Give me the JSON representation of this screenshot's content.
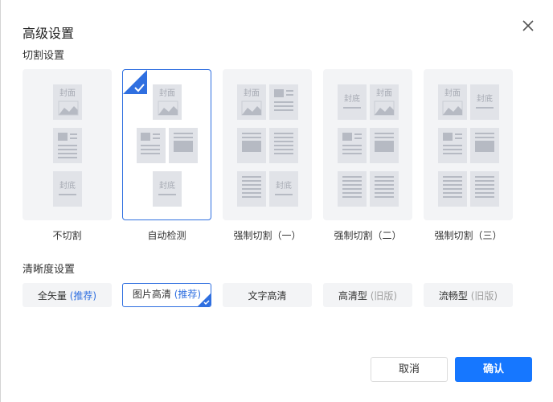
{
  "dialog": {
    "title": "高级设置",
    "close_icon": "close-icon"
  },
  "split_section": {
    "label": "切割设置",
    "options": [
      {
        "label": "不切割",
        "selected": false
      },
      {
        "label": "自动检测",
        "selected": true
      },
      {
        "label": "强制切割（一）",
        "selected": false
      },
      {
        "label": "强制切割（二）",
        "selected": false
      },
      {
        "label": "强制切割（三）",
        "selected": false
      }
    ],
    "thumb_text": {
      "cover": "封面",
      "back": "封底"
    }
  },
  "clarity_section": {
    "label": "清晰度设置",
    "options": [
      {
        "label": "全矢量",
        "tag": "(推荐)",
        "tag_style": "blue",
        "selected": false
      },
      {
        "label": "图片高清",
        "tag": "(推荐)",
        "tag_style": "blue",
        "selected": true
      },
      {
        "label": "文字高清",
        "tag": "",
        "tag_style": "",
        "selected": false
      },
      {
        "label": "高清型",
        "tag": "(旧版)",
        "tag_style": "gray",
        "selected": false
      },
      {
        "label": "流畅型",
        "tag": "(旧版)",
        "tag_style": "gray",
        "selected": false
      }
    ]
  },
  "footer": {
    "cancel_label": "取消",
    "ok_label": "确认"
  },
  "colors": {
    "accent": "#1677ff",
    "selected_border": "#2f6fe0",
    "card_bg": "#f3f4f6",
    "thumb_bg": "#e1e3e8",
    "thumb_fg": "#b6bac3"
  }
}
